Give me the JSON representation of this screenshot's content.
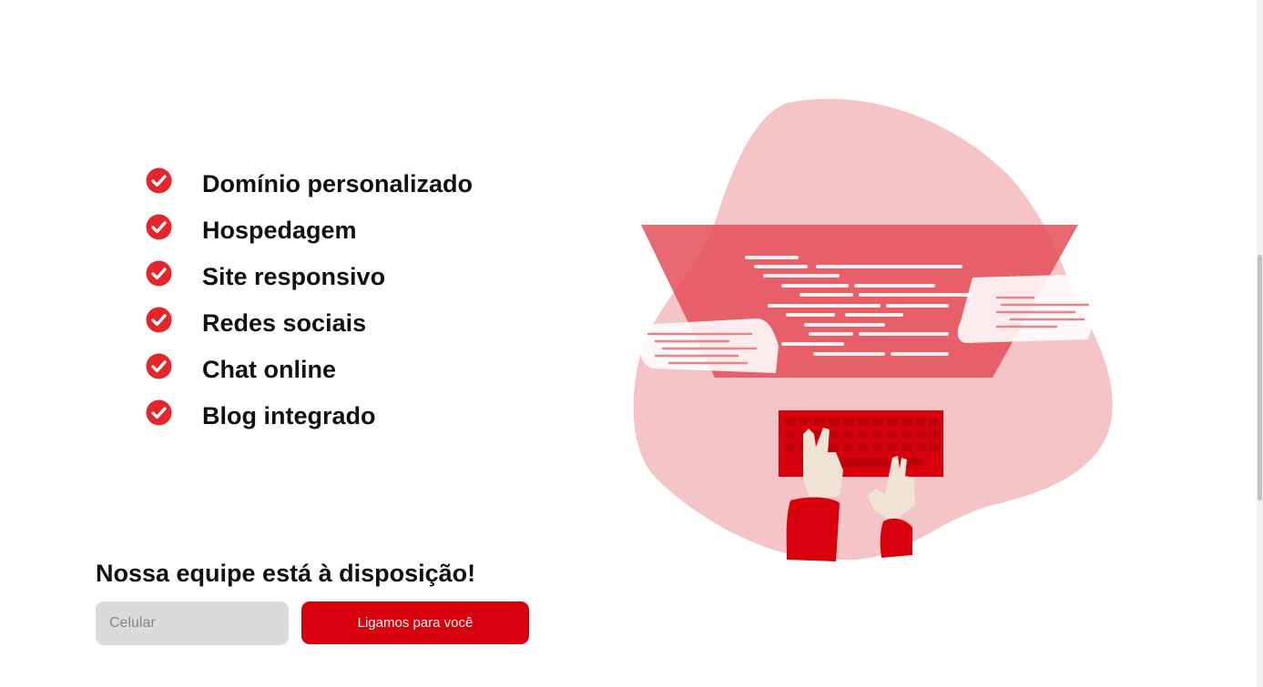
{
  "features": [
    {
      "label": "Domínio personalizado"
    },
    {
      "label": "Hospedagem"
    },
    {
      "label": "Site responsivo"
    },
    {
      "label": "Redes sociais"
    },
    {
      "label": "Chat online"
    },
    {
      "label": "Blog integrado"
    }
  ],
  "cta": {
    "title": "Nossa equipe está à disposição!",
    "phone_placeholder": "Celular",
    "phone_value": "",
    "button_label": "Ligamos para você"
  },
  "colors": {
    "accent": "#d9000d",
    "check": "#e3262b",
    "blob": "#f5c4c6",
    "screen": "#e65a62",
    "input_bg": "#dddbda"
  },
  "icons": {
    "feature_check": "check-circle-icon",
    "illustration": "developer-coding-illustration"
  }
}
